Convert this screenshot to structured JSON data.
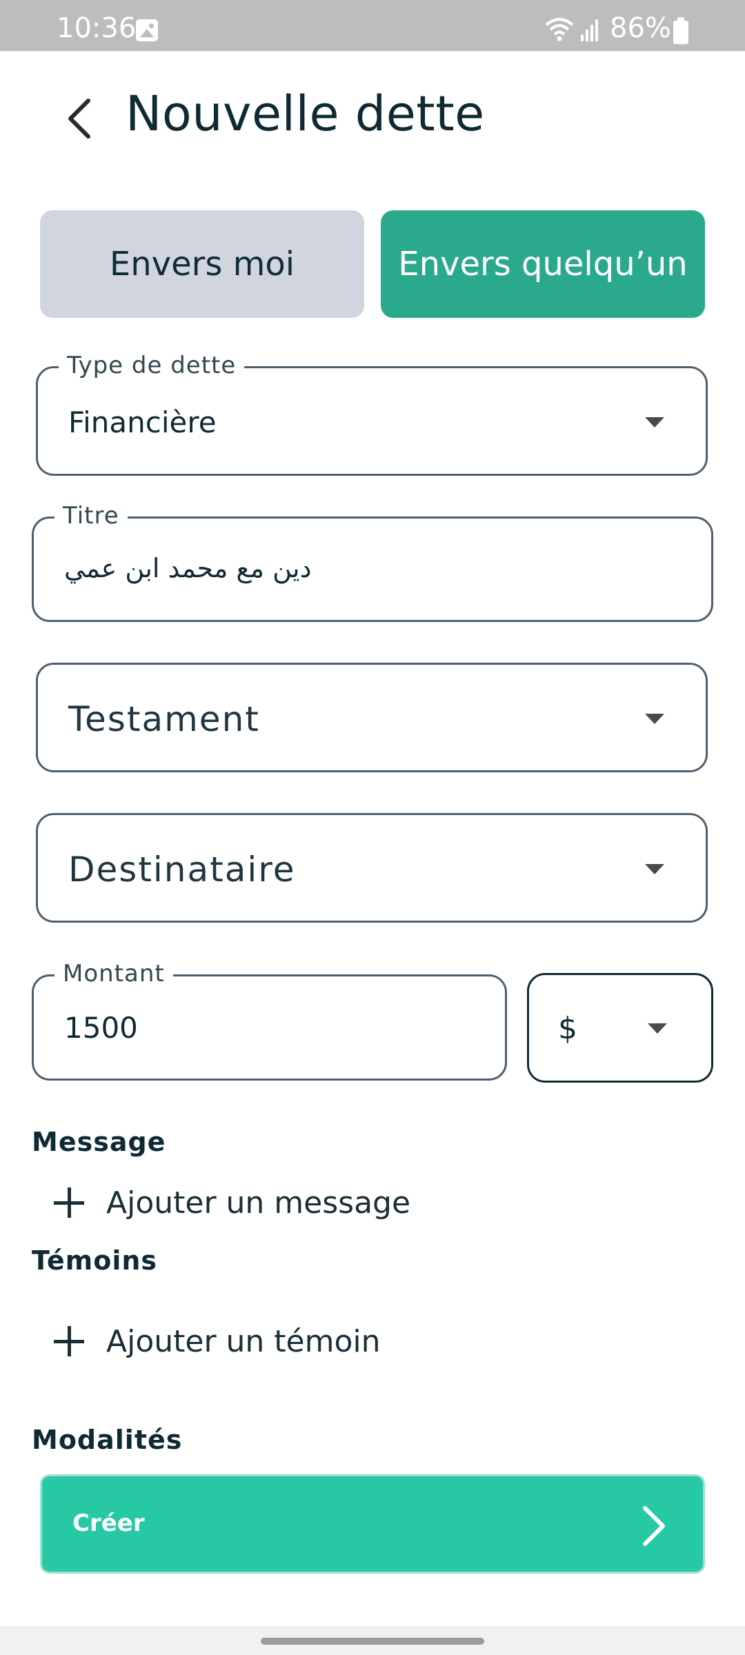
{
  "status_bar": {
    "time": "10:36",
    "battery": "86%"
  },
  "header": {
    "title": "Nouvelle dette"
  },
  "direction_toggle": {
    "left": "Envers moi",
    "right": "Envers quelqu’un",
    "selected": "right"
  },
  "form": {
    "debt_type": {
      "label": "Type de dette",
      "value": "Financière"
    },
    "title": {
      "label": "Titre",
      "value": "دين مع محمد ابن عمي"
    },
    "testament": {
      "placeholder": "Testament"
    },
    "recipient": {
      "placeholder": "Destinataire"
    },
    "amount": {
      "label": "Montant",
      "value": "1500"
    },
    "currency": {
      "value": "$"
    }
  },
  "sections": {
    "message": {
      "title": "Message",
      "add_label": "Ajouter un message"
    },
    "witnesses": {
      "title": "Témoins",
      "add_label": "Ajouter un témoin"
    },
    "terms": {
      "title": "Modalités"
    }
  },
  "create_button": {
    "label": "Créer"
  },
  "colors": {
    "accent": "#2ba98c",
    "create": "#26c9a4",
    "inactive_segment": "#d1d5de"
  }
}
